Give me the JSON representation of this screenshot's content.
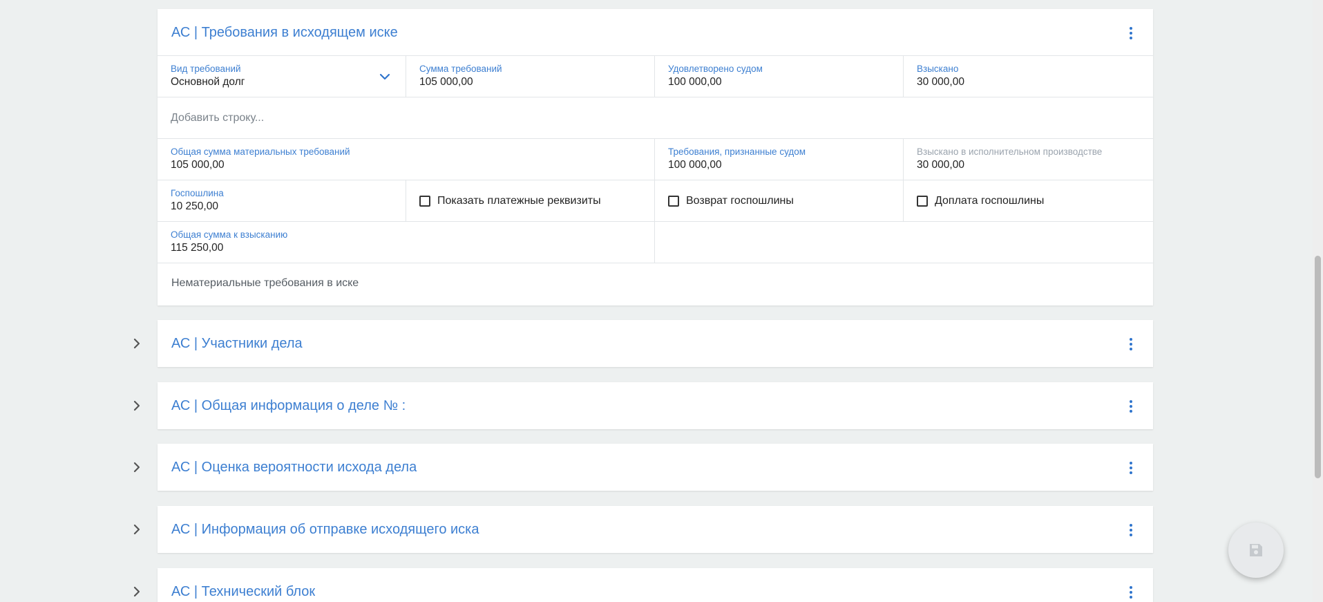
{
  "claims_card": {
    "title": "АС | Требования в исходящем иске",
    "claim_type_label": "Вид требований",
    "claim_type_value": "Основной долг",
    "claim_amount_label": "Сумма требований",
    "claim_amount_value": "105 000,00",
    "satisfied_label": "Удовлетворено судом",
    "satisfied_value": "100 000,00",
    "recovered_label": "Взыскано",
    "recovered_value": "30 000,00",
    "add_row": "Добавить строку...",
    "total_material_label": "Общая сумма материальных требований",
    "total_material_value": "105 000,00",
    "recognized_label": "Требования, признанные судом",
    "recognized_value": "100 000,00",
    "enforcement_label": "Взыскано в исполнительном производстве",
    "enforcement_value": "30 000,00",
    "fee_label": "Госпошлина",
    "fee_value": "10 250,00",
    "show_payment_label": "Показать платежные реквизиты",
    "fee_return_label": "Возврат госпошлины",
    "fee_surcharge_label": "Доплата госпошлины",
    "total_recovery_label": "Общая сумма к взысканию",
    "total_recovery_value": "115 250,00",
    "nonmaterial_label": "Нематериальные требования в иске"
  },
  "sections": [
    {
      "title": "АС | Участники дела"
    },
    {
      "title": "АС | Общая информация о деле № :"
    },
    {
      "title": "АС | Оценка вероятности исхода дела"
    },
    {
      "title": "АС | Информация об отправке исходящего иска"
    },
    {
      "title": "АС | Технический блок"
    }
  ],
  "icons": {
    "kebab": "more-vertical-icon",
    "expand": "chevron-right-icon",
    "dropdown": "chevron-down-icon",
    "save": "save-icon"
  },
  "colors": {
    "accent": "#3d7fd1",
    "background": "#edf0f0",
    "card": "#ffffff"
  }
}
